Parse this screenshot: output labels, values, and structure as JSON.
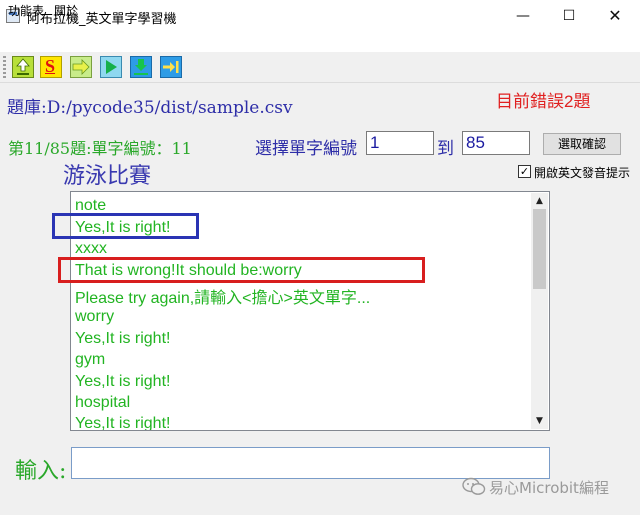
{
  "window": {
    "title": "阿布拉機_英文單字學習機",
    "minimize_glyph": "—",
    "maximize_glyph": "☐",
    "close_glyph": "✕"
  },
  "menu": [
    "功能表",
    "關於"
  ],
  "toolbar": {
    "icons": [
      "upload-icon",
      "s-letter-icon",
      "arrow-right-icon",
      "play-icon",
      "download-icon",
      "skip-to-end-icon"
    ],
    "s_letter": "S"
  },
  "bank_label": "題庫:D:/pycode35/dist/sample.csv",
  "error_count": "目前錯誤2題",
  "progress_label": "第11/85題:單字編號：11",
  "select_label": "選擇單字編號",
  "from_value": "1",
  "to_label": "到",
  "to_value": "85",
  "confirm_label": "選取確認",
  "chinese_word": "游泳比賽",
  "tts_checkbox": {
    "checked": true,
    "mark": "✓",
    "label": "開啟英文發音提示"
  },
  "log_lines": [
    "note",
    "Yes,It is right!",
    "xxxx",
    "That is wrong!It should be:worry",
    "Please try again,請輸入<擔心>英文單字...",
    "worry",
    "Yes,It is right!",
    "gym",
    "Yes,It is right!",
    "hospital",
    "Yes,It is right!"
  ],
  "scrollbar": {
    "up": "▲",
    "down": "▼"
  },
  "input_label": "輸入:",
  "answer_value": "",
  "watermark": "易心Microbit編程",
  "colors": {
    "log_text": "#22b422",
    "error_text": "#e02020",
    "label_blue": "#2e2ea8",
    "highlight_blue": "#2a34b4",
    "highlight_red": "#d81e1e"
  }
}
